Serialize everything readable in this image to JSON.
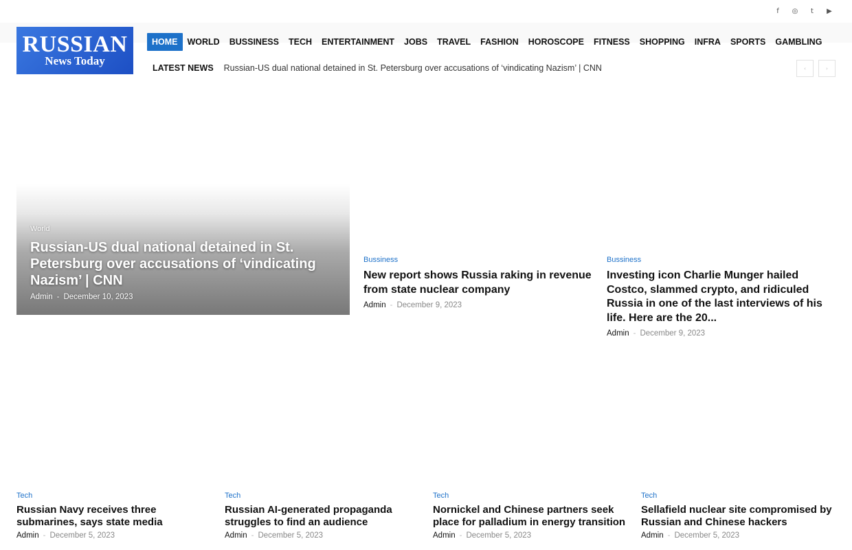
{
  "topbar": {
    "social_icons": [
      "facebook-icon",
      "instagram-icon",
      "twitter-icon",
      "youtube-icon"
    ]
  },
  "logo": {
    "line1": "RUSSIAN",
    "line2": "News Today",
    "color": "#2463d6"
  },
  "nav": {
    "items": [
      "HOME",
      "WORLD",
      "BUSSINESS",
      "TECH",
      "ENTERTAINMENT",
      "JOBS",
      "TRAVEL",
      "FASHION",
      "HOROSCOPE",
      "FITNESS",
      "SHOPPING",
      "INFRA",
      "SPORTS",
      "GAMBLING"
    ],
    "active": "HOME",
    "accent": "#1d71c9"
  },
  "ticker": {
    "label": "LATEST NEWS",
    "headline": "Russian-US dual national detained in St. Petersburg over accusations of ‘vindicating Nazism’ | CNN",
    "prev_icon": "chevron-left-icon",
    "next_icon": "chevron-right-icon"
  },
  "hero": {
    "category": "World",
    "title": "Russian-US dual national detained in St. Petersburg over accusations of ‘vindicating Nazism’ | CNN",
    "author": "Admin",
    "sep": "-",
    "date": "December 10, 2023"
  },
  "featured": [
    {
      "category": "Bussiness",
      "title": "New report shows Russia raking in revenue from state nuclear company",
      "author": "Admin",
      "sep": "-",
      "date": "December 9, 2023"
    },
    {
      "category": "Bussiness",
      "title": "Investing icon Charlie Munger hailed Costco, slammed crypto, and ridiculed Russia in one of the last interviews of his life. Here are the 20...",
      "author": "Admin",
      "sep": "-",
      "date": "December 9, 2023"
    }
  ],
  "tech": [
    {
      "category": "Tech",
      "title": "Russian Navy receives three submarines, says state media",
      "author": "Admin",
      "sep": "-",
      "date": "December 5, 2023"
    },
    {
      "category": "Tech",
      "title": "Russian AI-generated propaganda struggles to find an audience",
      "author": "Admin",
      "sep": "-",
      "date": "December 5, 2023"
    },
    {
      "category": "Tech",
      "title": "Nornickel and Chinese partners seek place for palladium in energy transition",
      "author": "Admin",
      "sep": "-",
      "date": "December 5, 2023"
    },
    {
      "category": "Tech",
      "title": "Sellafield nuclear site compromised by Russian and Chinese hackers",
      "author": "Admin",
      "sep": "-",
      "date": "December 5, 2023"
    }
  ]
}
